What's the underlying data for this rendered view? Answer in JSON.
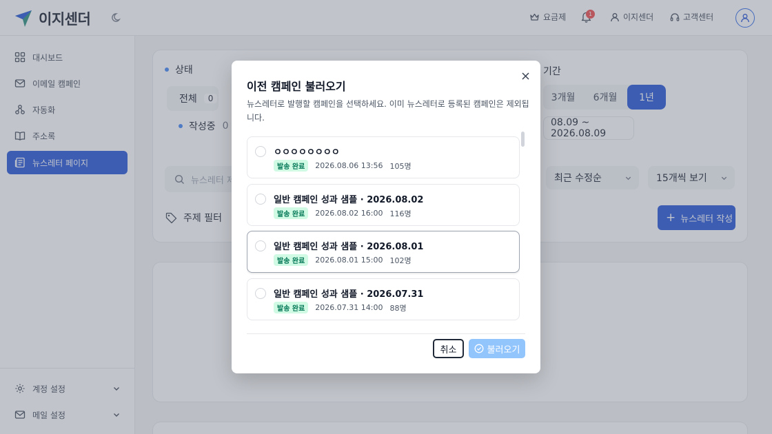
{
  "app": {
    "name": "이지센더"
  },
  "header": {
    "pricing": "요금제",
    "notification_count": "1",
    "account": "이지센더",
    "support": "고객센터"
  },
  "sidebar": {
    "items": [
      {
        "label": "대시보드",
        "icon": "dashboard-icon"
      },
      {
        "label": "이메일 캠페인",
        "icon": "mail-icon"
      },
      {
        "label": "자동화",
        "icon": "automation-icon"
      },
      {
        "label": "주소록",
        "icon": "book-icon"
      },
      {
        "label": "뉴스레터 페이지",
        "icon": "newspaper-icon",
        "active": true
      }
    ],
    "bottom": [
      {
        "label": "계정 설정",
        "icon": "gear-icon"
      },
      {
        "label": "메일 설정",
        "icon": "mail-icon"
      }
    ]
  },
  "main": {
    "status_label": "상태",
    "all_label": "전체",
    "all_count": "0",
    "draft_label": "작성중",
    "draft_count": "0",
    "period_label": "기간",
    "periods": [
      "3개월",
      "6개월",
      "1년"
    ],
    "selected_period": "1년",
    "date_range": "08.09 ~ 2026.08.09",
    "search_placeholder": "뉴스레터 제",
    "sort": "최근 수정순",
    "page_size": "15개씩 보기",
    "topic_filter": "주제 필터",
    "write_button": "뉴스레터 작성"
  },
  "modal": {
    "title": "이전 캠페인 불러오기",
    "description": "뉴스레터로 발행할 캠페인을 선택하세요. 이미 뉴스레터로 등록된 캠페인은 제외됩니다.",
    "items": [
      {
        "title": "ㅇㅇㅇㅇㅇㅇㅇㅇ",
        "status": "발송 완료",
        "datetime": "2026.08.06 13:56",
        "recipients": "105명"
      },
      {
        "title": "일반 캠페인 성과 샘플 · 2026.08.02",
        "status": "발송 완료",
        "datetime": "2026.08.02 16:00",
        "recipients": "116명"
      },
      {
        "title": "일반 캠페인 성과 샘플 · 2026.08.01",
        "status": "발송 완료",
        "datetime": "2026.08.01 15:00",
        "recipients": "102명"
      },
      {
        "title": "일반 캠페인 성과 샘플 · 2026.07.31",
        "status": "발송 완료",
        "datetime": "2026.07.31 14:00",
        "recipients": "88명"
      }
    ],
    "cancel_label": "취소",
    "load_label": "불러오기"
  },
  "colors": {
    "accent": "#1d4ed8",
    "badge_bg": "#d1fae5",
    "badge_text": "#047857",
    "load_button": "#93c5fd"
  }
}
